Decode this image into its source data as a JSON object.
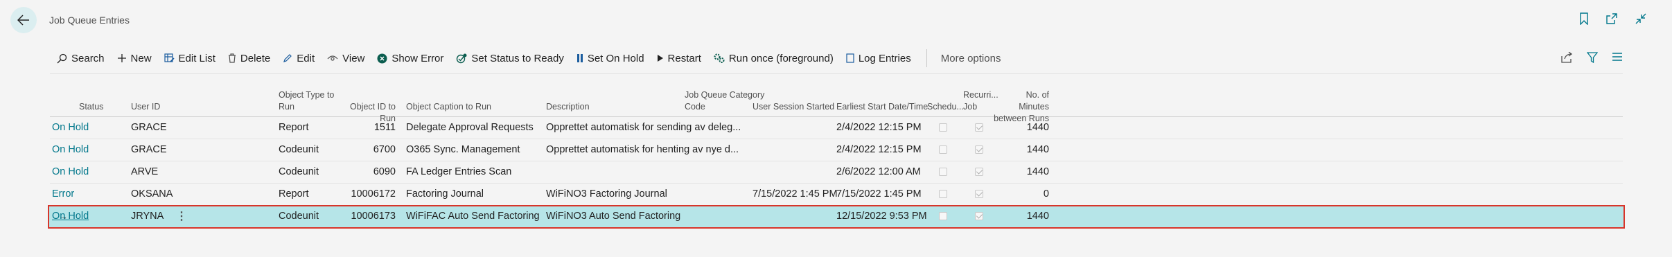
{
  "page": {
    "title": "Job Queue Entries"
  },
  "actions": {
    "search": "Search",
    "new": "New",
    "edit_list": "Edit List",
    "delete": "Delete",
    "edit": "Edit",
    "view": "View",
    "show_error": "Show Error",
    "set_status_ready": "Set Status to Ready",
    "set_on_hold": "Set On Hold",
    "restart": "Restart",
    "run_once": "Run once (foreground)",
    "log_entries": "Log Entries",
    "more_options": "More options"
  },
  "columns": {
    "status": "Status",
    "user_id": "User ID",
    "object_type_1": "Object Type to",
    "object_type_2": "Run",
    "object_id": "Object ID to Run",
    "object_caption": "Object Caption to Run",
    "description": "Description",
    "category_1": "Job Queue Category",
    "category_2": "Code",
    "session_started": "User Session Started",
    "earliest_start": "Earliest Start Date/Time",
    "scheduled": "Schedu...",
    "recurring_1": "Recurri...",
    "recurring_2": "Job",
    "minutes_1": "No. of Minutes",
    "minutes_2": "between Runs"
  },
  "rows": [
    {
      "status": "On Hold",
      "user_id": "GRACE",
      "object_type": "Report",
      "object_id": "1511",
      "caption": "Delegate Approval Requests",
      "description": "Opprettet automatisk for sending av deleg...",
      "category": "",
      "session_started": "",
      "earliest_start": "2/4/2022 12:15 PM",
      "scheduled": false,
      "recurring": true,
      "minutes": "1440"
    },
    {
      "status": "On Hold",
      "user_id": "GRACE",
      "object_type": "Codeunit",
      "object_id": "6700",
      "caption": "O365 Sync. Management",
      "description": "Opprettet automatisk for henting av nye d...",
      "category": "",
      "session_started": "",
      "earliest_start": "2/4/2022 12:15 PM",
      "scheduled": false,
      "recurring": true,
      "minutes": "1440"
    },
    {
      "status": "On Hold",
      "user_id": "ARVE",
      "object_type": "Codeunit",
      "object_id": "6090",
      "caption": "FA Ledger Entries Scan",
      "description": "",
      "category": "",
      "session_started": "",
      "earliest_start": "2/6/2022 12:00 AM",
      "scheduled": false,
      "recurring": true,
      "minutes": "1440"
    },
    {
      "status": "Error",
      "user_id": "OKSANA",
      "object_type": "Report",
      "object_id": "10006172",
      "caption": "Factoring Journal",
      "description": "WiFiNO3 Factoring Journal",
      "category": "",
      "session_started": "7/15/2022 1:45 PM",
      "earliest_start": "7/15/2022 1:45 PM",
      "scheduled": false,
      "recurring": true,
      "minutes": "0"
    },
    {
      "status": "On Hold",
      "user_id": "JRYNA",
      "object_type": "Codeunit",
      "object_id": "10006173",
      "caption": "WiFiFAC Auto Send Factoring",
      "description": "WiFiNO3 Auto Send Factoring",
      "category": "",
      "session_started": "",
      "earliest_start": "12/15/2022 9:53 PM",
      "scheduled": false,
      "recurring": true,
      "minutes": "1440",
      "selected": true
    }
  ]
}
